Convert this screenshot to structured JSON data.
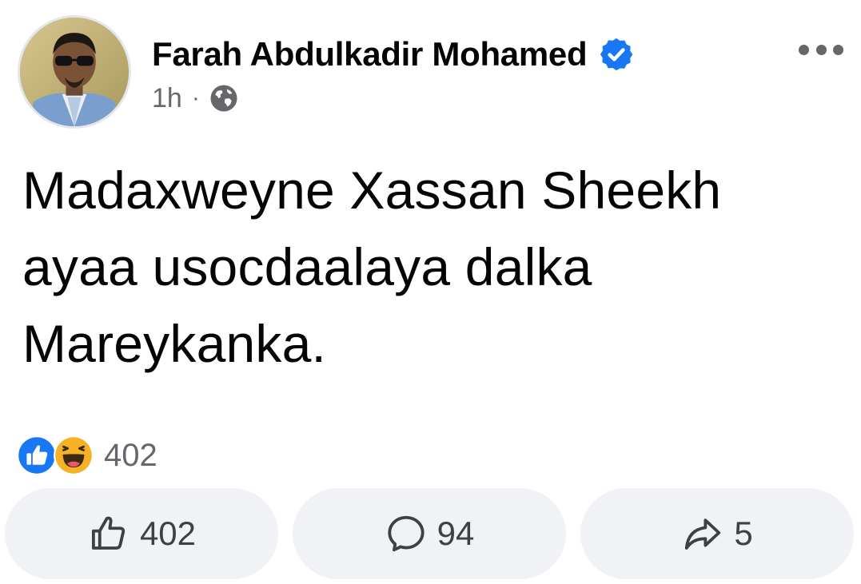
{
  "post": {
    "author_name": "Farah Abdulkadir Mohamed",
    "verified": true,
    "timestamp": "1h",
    "separator": "·",
    "audience_icon": "globe-icon",
    "text": "Madaxweyne Xassan Sheekh ayaa usocdaalaya dalka Mareykanka.",
    "menu_icon": "more-horizontal-icon"
  },
  "reactions": {
    "types": [
      "like",
      "haha"
    ],
    "count": "402"
  },
  "actions": {
    "like": {
      "icon": "thumbs-up-icon",
      "count": "402"
    },
    "comment": {
      "icon": "comment-bubble-icon",
      "count": "94"
    },
    "share": {
      "icon": "share-arrow-icon",
      "count": "5"
    }
  },
  "colors": {
    "brand_blue": "#1877f2",
    "text_primary": "#050505",
    "text_secondary": "#65676b",
    "button_bg": "#f0f2f5",
    "haha_yellow": "#f7b125"
  }
}
